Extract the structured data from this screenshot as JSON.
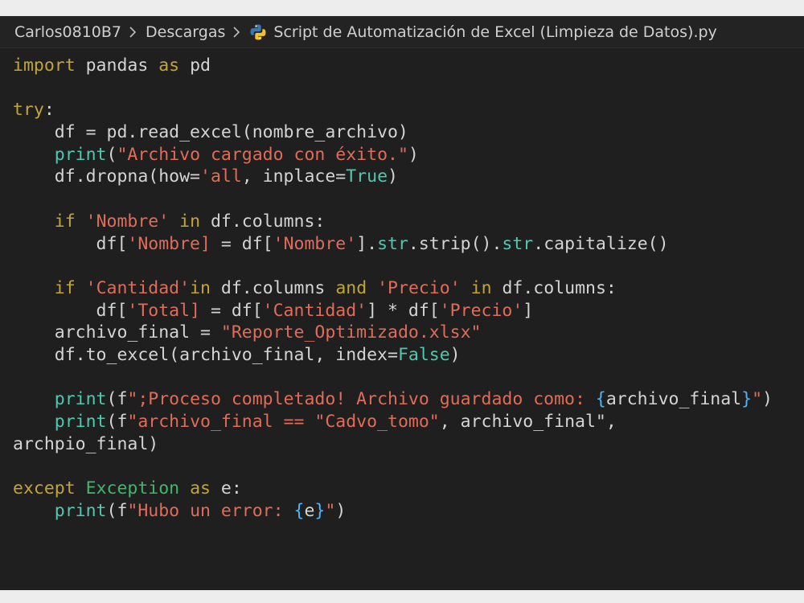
{
  "breadcrumb": {
    "items": [
      "Carlos0810B7",
      "Descargas",
      "Script de Automatización de Excel (Limpieza de Datos).py"
    ],
    "file_icon": "python-icon",
    "separator_icon": "chevron-right-icon"
  },
  "colors": {
    "keyword": "#c2a537",
    "builtin": "#4ec9b0",
    "string": "#e06c5a",
    "brace": "#4fb3f6",
    "identifier": "#d4d4d4",
    "class": "#3fb86a",
    "background": "#1f1f1f"
  },
  "code": {
    "lines": [
      [
        [
          "kw",
          "import"
        ],
        [
          "id",
          " pandas "
        ],
        [
          "kw",
          "as"
        ],
        [
          "id",
          " pd"
        ]
      ],
      [],
      [
        [
          "kw",
          "try"
        ],
        [
          "id",
          ":"
        ]
      ],
      [
        [
          "id",
          "    df = pd.read_excel(nombre_archivo)"
        ]
      ],
      [
        [
          "id",
          "    "
        ],
        [
          "fn",
          "print"
        ],
        [
          "id",
          "("
        ],
        [
          "str",
          "\"Archivo cargado con éxito.\""
        ],
        [
          "id",
          ")"
        ]
      ],
      [
        [
          "id",
          "    df.dropna(how="
        ],
        [
          "str",
          "'all"
        ],
        [
          "id",
          ", inplace="
        ],
        [
          "bool",
          "True"
        ],
        [
          "id",
          ")"
        ]
      ],
      [],
      [
        [
          "id",
          "    "
        ],
        [
          "kw",
          "if"
        ],
        [
          "id",
          " "
        ],
        [
          "str",
          "'Nombre'"
        ],
        [
          "id",
          " "
        ],
        [
          "kw",
          "in"
        ],
        [
          "id",
          " df.columns:"
        ]
      ],
      [
        [
          "id",
          "        df["
        ],
        [
          "str",
          "'Nombre]"
        ],
        [
          "id",
          " = df["
        ],
        [
          "str",
          "'Nombre'"
        ],
        [
          "id",
          "]."
        ],
        [
          "fn",
          "str"
        ],
        [
          "id",
          ".strip()."
        ],
        [
          "fn",
          "str"
        ],
        [
          "id",
          ".capitalize()"
        ]
      ],
      [],
      [
        [
          "id",
          "    "
        ],
        [
          "kw",
          "if"
        ],
        [
          "id",
          " "
        ],
        [
          "str",
          "'Cantidad'"
        ],
        [
          "kw",
          "in"
        ],
        [
          "id",
          " df.columns "
        ],
        [
          "kw",
          "and"
        ],
        [
          "id",
          " "
        ],
        [
          "str",
          "'Precio'"
        ],
        [
          "id",
          " "
        ],
        [
          "kw",
          "in"
        ],
        [
          "id",
          " df.columns:"
        ]
      ],
      [
        [
          "id",
          "        df["
        ],
        [
          "str",
          "'Total]"
        ],
        [
          "id",
          " = df["
        ],
        [
          "str",
          "'Cantidad'"
        ],
        [
          "id",
          "] * df["
        ],
        [
          "str",
          "'Precio'"
        ],
        [
          "id",
          "]"
        ]
      ],
      [
        [
          "id",
          "    archivo_final = "
        ],
        [
          "str",
          "\"Reporte_Optimizado.xlsx\""
        ]
      ],
      [
        [
          "id",
          "    df.to_excel(archivo_final, index="
        ],
        [
          "bool",
          "False"
        ],
        [
          "id",
          ")"
        ]
      ],
      [],
      [
        [
          "id",
          "    "
        ],
        [
          "fn",
          "print"
        ],
        [
          "id",
          "(f"
        ],
        [
          "str",
          "\";Proceso completado! Archivo guardado como: "
        ],
        [
          "brace",
          "{"
        ],
        [
          "id",
          "archivo_final"
        ],
        [
          "brace",
          "}"
        ],
        [
          "str",
          "\""
        ],
        [
          "id",
          ")"
        ]
      ],
      [
        [
          "id",
          "    "
        ],
        [
          "fn",
          "print"
        ],
        [
          "id",
          "(f"
        ],
        [
          "str",
          "\"archivo_final == \"Cadvo_tomo\""
        ],
        [
          "id",
          ", archivo_final\","
        ]
      ],
      [
        [
          "id",
          "archpio_final)"
        ]
      ],
      [],
      [
        [
          "kw",
          "except"
        ],
        [
          "id",
          " "
        ],
        [
          "cls",
          "Exception"
        ],
        [
          "id",
          " "
        ],
        [
          "kw",
          "as"
        ],
        [
          "id",
          " e:"
        ]
      ],
      [
        [
          "id",
          "    "
        ],
        [
          "fn",
          "print"
        ],
        [
          "id",
          "(f"
        ],
        [
          "str",
          "\"Hubo un error: "
        ],
        [
          "brace",
          "{"
        ],
        [
          "id",
          "e"
        ],
        [
          "brace",
          "}"
        ],
        [
          "str",
          "\""
        ],
        [
          "id",
          ")"
        ]
      ]
    ]
  }
}
